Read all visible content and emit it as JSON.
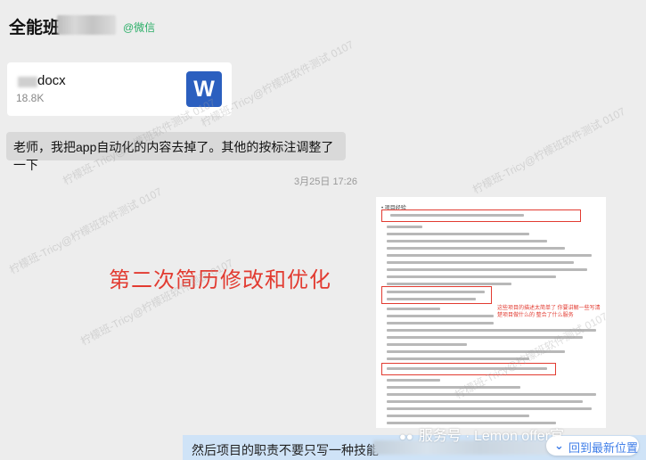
{
  "header": {
    "chat_title": "全能班-",
    "tag": "@微信"
  },
  "messages": {
    "file": {
      "name": "docx",
      "size": "18.8K",
      "icon_letter": "W",
      "icon": "word-document-icon"
    },
    "text": "老师，我把app自动化的内容去掉了。其他的按标注调整了一下",
    "timestamp": "3月25日 17:26",
    "image": {
      "overlay_text": "第二次简历修改和优化",
      "annotation": "这些项目的描述太简单了 你要讲解一些写清楚项目做什么的 整合了什么服务"
    }
  },
  "bottom": {
    "draft_text": "然后项目的职责不要只写一种技能",
    "service_label": "服务号 · Lemon offer官",
    "latest_button": "回到最新位置"
  },
  "watermark": "柠檬班-Tricy@柠檬班软件测试 0107",
  "colors": {
    "background": "#ededed",
    "wechat_green": "#2aae67",
    "word_blue": "#2b5fbf",
    "annotation_red": "#e23b31",
    "link_blue": "#3f7ee8"
  }
}
